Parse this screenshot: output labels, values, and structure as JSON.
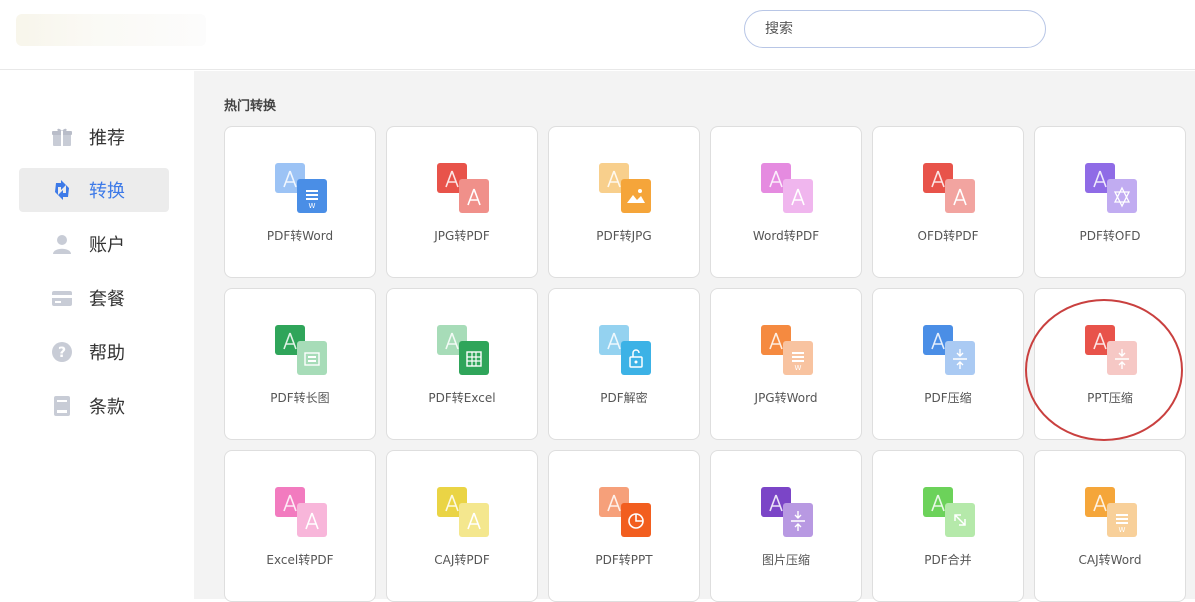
{
  "search": {
    "placeholder": "搜索"
  },
  "sidebar": {
    "items": [
      {
        "label": "推荐",
        "icon": "gift-icon"
      },
      {
        "label": "转换",
        "icon": "convert-icon",
        "active": true
      },
      {
        "label": "账户",
        "icon": "user-icon"
      },
      {
        "label": "套餐",
        "icon": "card-icon"
      },
      {
        "label": "帮助",
        "icon": "help-icon"
      },
      {
        "label": "条款",
        "icon": "document-icon"
      }
    ]
  },
  "main": {
    "section_title": "热门转换",
    "tools": [
      {
        "label": "PDF转Word",
        "icon": "pdf-to-word-icon",
        "back": "#9cc3f5",
        "front": "#4a8ee6",
        "front_glyph": "W"
      },
      {
        "label": "JPG转PDF",
        "icon": "jpg-to-pdf-icon",
        "back": "#e8534a",
        "front": "#f0908a",
        "front_glyph": "A"
      },
      {
        "label": "PDF转JPG",
        "icon": "pdf-to-jpg-icon",
        "back": "#f8cf8c",
        "front": "#f5a53a",
        "front_glyph": "M"
      },
      {
        "label": "Word转PDF",
        "icon": "word-to-pdf-icon",
        "back": "#e58be0",
        "front": "#f0b6ee",
        "front_glyph": "A"
      },
      {
        "label": "OFD转PDF",
        "icon": "ofd-to-pdf-icon",
        "back": "#e8534a",
        "front": "#f2a4a0",
        "front_glyph": "A"
      },
      {
        "label": "PDF转OFD",
        "icon": "pdf-to-ofd-icon",
        "back": "#8f6be6",
        "front": "#c1acf1",
        "front_glyph": "S"
      },
      {
        "label": "PDF转长图",
        "icon": "pdf-to-long-image-icon",
        "back": "#2fa55a",
        "front": "#a7dcb8",
        "front_glyph": "I"
      },
      {
        "label": "PDF转Excel",
        "icon": "pdf-to-excel-icon",
        "back": "#a7dcb8",
        "front": "#2fa55a",
        "front_glyph": "T"
      },
      {
        "label": "PDF解密",
        "icon": "pdf-decrypt-icon",
        "back": "#94d2f0",
        "front": "#3cb2e6",
        "front_glyph": "L"
      },
      {
        "label": "JPG转Word",
        "icon": "jpg-to-word-icon",
        "back": "#f58a40",
        "front": "#f8c3a0",
        "front_glyph": "W"
      },
      {
        "label": "PDF压缩",
        "icon": "pdf-compress-icon",
        "back": "#4a8ee6",
        "front": "#aacaf3",
        "front_glyph": "C"
      },
      {
        "label": "PPT压缩",
        "icon": "ppt-compress-icon",
        "back": "#e8534a",
        "front": "#f6c8c5",
        "front_glyph": "C"
      },
      {
        "label": "Excel转PDF",
        "icon": "excel-to-pdf-icon",
        "back": "#f27bbf",
        "front": "#f8b6da",
        "front_glyph": "A"
      },
      {
        "label": "CAJ转PDF",
        "icon": "caj-to-pdf-icon",
        "back": "#ead445",
        "front": "#f4e78e",
        "front_glyph": "A"
      },
      {
        "label": "PDF转PPT",
        "icon": "pdf-to-ppt-icon",
        "back": "#f6a07a",
        "front": "#f25e1f",
        "front_glyph": "P"
      },
      {
        "label": "图片压缩",
        "icon": "image-compress-icon",
        "back": "#7b45c7",
        "front": "#b899e2",
        "front_glyph": "C"
      },
      {
        "label": "PDF合并",
        "icon": "pdf-merge-icon",
        "back": "#6cd25a",
        "front": "#b5e9aa",
        "front_glyph": "G"
      },
      {
        "label": "CAJ转Word",
        "icon": "caj-to-word-icon",
        "back": "#f5a63a",
        "front": "#f8d09a",
        "front_glyph": "W"
      }
    ]
  },
  "highlight": {
    "target": "PPT压缩",
    "color": "#c9403f"
  }
}
